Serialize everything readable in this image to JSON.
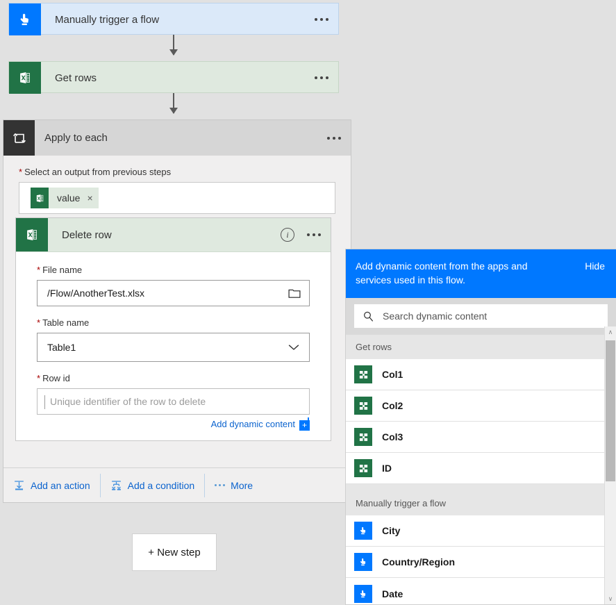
{
  "flow": {
    "trigger": {
      "title": "Manually trigger a flow",
      "icon": "touch-trigger-icon",
      "color": "#0078ff"
    },
    "get_rows": {
      "title": "Get rows",
      "icon": "excel-icon",
      "color": "#217346"
    },
    "apply_to_each": {
      "title": "Apply to each",
      "icon": "loop-icon",
      "color": "#333333",
      "select_output_label": "Select an output from previous steps",
      "required_marker": "*",
      "token": {
        "label": "value",
        "remove": "×",
        "icon": "excel-icon"
      }
    },
    "delete_row": {
      "title": "Delete row",
      "icon": "excel-icon",
      "info_icon": "info-icon",
      "fields": [
        {
          "label": "File name",
          "value": "/Flow/AnotherTest.xlsx",
          "placeholder": "",
          "kind": "text",
          "trailing_icon": "folder-icon"
        },
        {
          "label": "Table name",
          "value": "Table1",
          "placeholder": "",
          "kind": "select",
          "trailing_icon": "chevron-down-icon"
        },
        {
          "label": "Row id",
          "value": "",
          "placeholder": "Unique identifier of the row to delete",
          "kind": "text",
          "trailing_icon": ""
        }
      ],
      "add_dynamic_content": "Add dynamic content"
    },
    "footer": {
      "add_action": "Add an action",
      "add_condition": "Add a condition",
      "more": "More"
    },
    "new_step": "+ New step"
  },
  "dynamic_panel": {
    "banner_text": "Add dynamic content from the apps and services used in this flow.",
    "hide_label": "Hide",
    "search_placeholder": "Search dynamic content",
    "search_icon": "search-icon",
    "groups": [
      {
        "name": "Get rows",
        "icon": "excel-dynamic-icon",
        "icon_color": "#217346",
        "items": [
          {
            "label": "Col1"
          },
          {
            "label": "Col2"
          },
          {
            "label": "Col3"
          },
          {
            "label": "ID"
          }
        ]
      },
      {
        "name": "Manually trigger a flow",
        "icon": "touch-trigger-icon",
        "icon_color": "#0078ff",
        "items": [
          {
            "label": "City"
          },
          {
            "label": "Country/Region"
          },
          {
            "label": "Date"
          }
        ]
      }
    ],
    "scrollbar": {
      "up": "∧",
      "down": "∨"
    }
  },
  "colors": {
    "canvas": "#e1e1e1",
    "trigger_blue": "#0078ff",
    "excel_green": "#217346",
    "loop_dark": "#333333",
    "link_blue": "#0b63ce",
    "required_red": "#a80000"
  }
}
